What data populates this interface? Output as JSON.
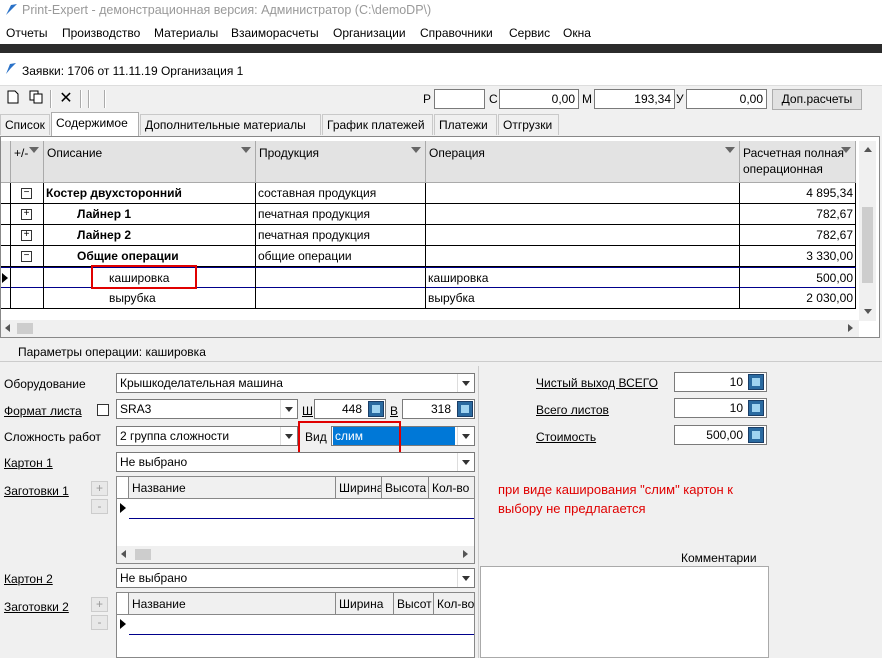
{
  "window": {
    "title": "Print-Expert - демонстрационная версия: Администратор (C:\\demoDP\\)"
  },
  "menu": [
    "Отчеты",
    "Производство",
    "Материалы",
    "Взаиморасчеты",
    "Организации",
    "Справочники",
    "Сервис",
    "Окна"
  ],
  "document": {
    "title": "Заявки: 1706 от 11.11.19  Организация 1"
  },
  "totals": {
    "p_label": "Р",
    "p_value": "",
    "c_label": "С",
    "c_value": "0,00",
    "m_label": "М",
    "m_value": "193,34",
    "u_label": "У",
    "u_value": "0,00",
    "calc_button": "Доп.расчеты"
  },
  "tabs": [
    "Список",
    "Содержимое",
    "Дополнительные материалы",
    "График платежей",
    "Платежи",
    "Отгрузки"
  ],
  "grid": {
    "headers": [
      "+/-",
      "Описание",
      "Продукция",
      "Операция",
      "Расчетная полная операционная"
    ],
    "rows": [
      {
        "expander": "−",
        "description": "Костер двухсторонний",
        "product": "составная продукция",
        "operation": "",
        "cost": "4 895,34"
      },
      {
        "expander": "+",
        "description": "Лайнер 1",
        "product": "печатная продукция",
        "operation": "",
        "cost": "782,67"
      },
      {
        "expander": "+",
        "description": "Лайнер 2",
        "product": "печатная продукция",
        "operation": "",
        "cost": "782,67"
      },
      {
        "expander": "−",
        "description": "Общие операции",
        "product": "общие операции",
        "operation": "",
        "cost": "3 330,00"
      },
      {
        "expander": "",
        "description": "кашировка",
        "product": "",
        "operation": "кашировка",
        "cost": "500,00"
      },
      {
        "expander": "",
        "description": "вырубка",
        "product": "",
        "operation": "вырубка",
        "cost": "2 030,00"
      }
    ]
  },
  "params": {
    "title": "Параметры операции: кашировка",
    "equipment_label": "Оборудование",
    "equipment_value": "Крышкоделательная машина",
    "format_label": "Формат листа",
    "format_value": "SRA3",
    "w_label": "Ш",
    "w_value": "448",
    "h_label": "В",
    "h_value": "318",
    "complexity_label": "Сложность работ",
    "complexity_value": "2 группа сложности",
    "vid_label": "Вид",
    "vid_value": "слим",
    "carton1_label": "Картон 1",
    "carton1_value": "Не выбрано",
    "blanks1_label": "Заготовки 1",
    "carton2_label": "Картон 2",
    "carton2_value": "Не выбрано",
    "blanks2_label": "Заготовки 2",
    "sub_headers1": [
      "Название",
      "Ширина",
      "Высота",
      "Кол-во"
    ],
    "sub_headers2": [
      "Название",
      "Ширина",
      "Высот",
      "Кол-во"
    ],
    "net_output_label": "Чистый выход ВСЕГО",
    "net_output_value": "10",
    "total_sheets_label": "Всего листов",
    "total_sheets_value": "10",
    "cost_label": "Стоимость",
    "cost_value": "500,00",
    "comments_label": "Комментарии",
    "note": "при виде каширования \"слим\" картон к выбору не предлагается"
  }
}
